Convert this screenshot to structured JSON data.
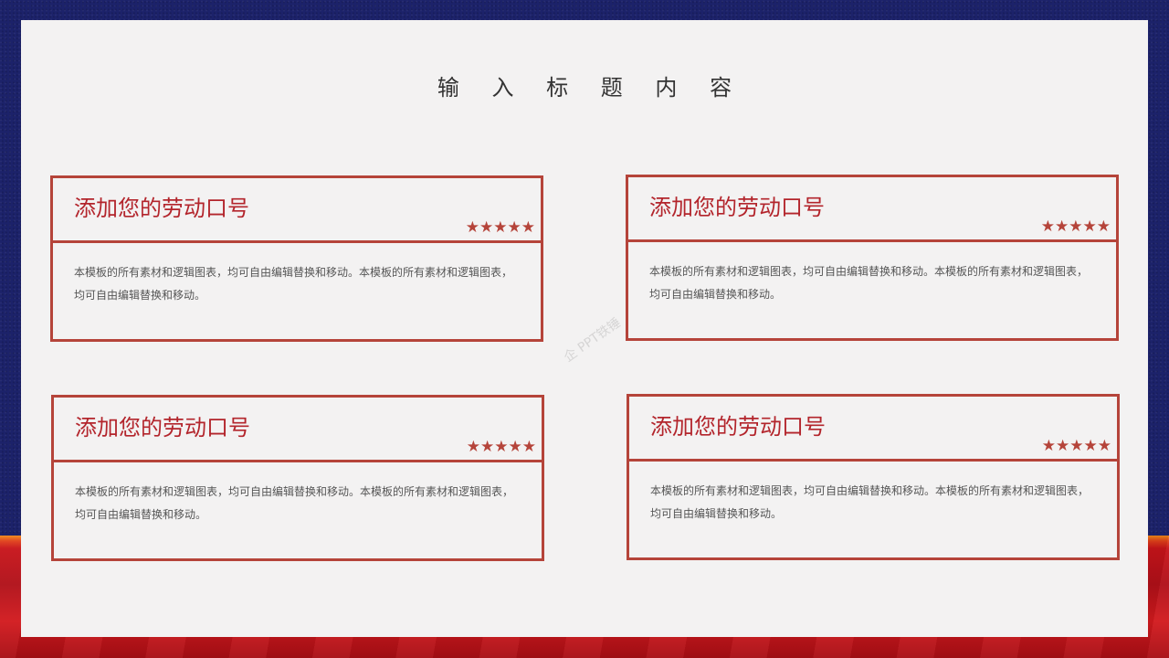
{
  "page": {
    "title": "输 入 标 题 内 容",
    "watermark": "企 PPT铁锤"
  },
  "cards": [
    {
      "title": "添加您的劳动口号",
      "stars": "★★★★★",
      "text": "本模板的所有素材和逻辑图表，均可自由编辑替换和移动。本模板的所有素材和逻辑图表，均可自由编辑替换和移动。"
    },
    {
      "title": "添加您的劳动口号",
      "stars": "★★★★★",
      "text": "本模板的所有素材和逻辑图表，均可自由编辑替换和移动。本模板的所有素材和逻辑图表，均可自由编辑替换和移动。"
    },
    {
      "title": "添加您的劳动口号",
      "stars": "★★★★★",
      "text": "本模板的所有素材和逻辑图表，均可自由编辑替换和移动。本模板的所有素材和逻辑图表，均可自由编辑替换和移动。"
    },
    {
      "title": "添加您的劳动口号",
      "stars": "★★★★★",
      "text": "本模板的所有素材和逻辑图表，均可自由编辑替换和移动。本模板的所有素材和逻辑图表，均可自由编辑替换和移动。"
    }
  ],
  "colors": {
    "background_blue": "#1c226a",
    "accent_red": "#b5443a",
    "title_red": "#b3252c",
    "panel": "#f3f2f2"
  }
}
